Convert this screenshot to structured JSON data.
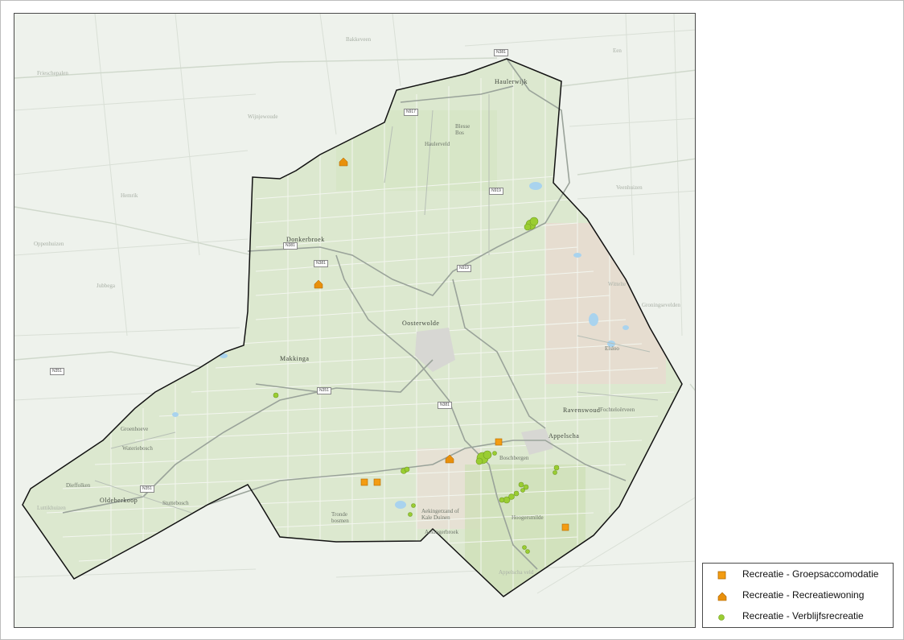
{
  "map": {
    "places": [
      {
        "name": "Haulerwijk",
        "cls": "town"
      },
      {
        "name": "Donkerbroek",
        "cls": "town"
      },
      {
        "name": "Oosterwolde",
        "cls": "town"
      },
      {
        "name": "Makkinga",
        "cls": "town"
      },
      {
        "name": "Appelscha",
        "cls": "town"
      },
      {
        "name": "Ravenswoud",
        "cls": "town"
      },
      {
        "name": "Oldeberkoop",
        "cls": "town"
      },
      {
        "name": "Haulerveld",
        "cls": ""
      },
      {
        "name": "Blesse Bos",
        "cls": ""
      },
      {
        "name": "Boschbergen",
        "cls": ""
      },
      {
        "name": "Hoogersmilde",
        "cls": ""
      },
      {
        "name": "Aekingerzand of Kale Duinen",
        "cls": ""
      },
      {
        "name": "Aekingerbroek",
        "cls": ""
      },
      {
        "name": "Tronde bosmen",
        "cls": ""
      },
      {
        "name": "Groenhoeve",
        "cls": ""
      },
      {
        "name": "Wateriebosch",
        "cls": ""
      },
      {
        "name": "Stuttebosch",
        "cls": ""
      },
      {
        "name": "Dieffolken",
        "cls": ""
      },
      {
        "name": "Fochteloërveen",
        "cls": ""
      },
      {
        "name": "Elsloo",
        "cls": ""
      },
      {
        "name": "Wijnjewoude",
        "cls": "faint"
      },
      {
        "name": "Hemrik",
        "cls": "faint"
      },
      {
        "name": "Jubbega",
        "cls": "faint"
      },
      {
        "name": "Oppenhuizen",
        "cls": "faint"
      },
      {
        "name": "Bakkeveen",
        "cls": "faint"
      },
      {
        "name": "Veenhuizen",
        "cls": "faint"
      },
      {
        "name": "Een",
        "cls": "faint"
      },
      {
        "name": "Wittelte",
        "cls": "faint"
      },
      {
        "name": "Frieschepalen",
        "cls": "faint"
      },
      {
        "name": "Appelscha veld",
        "cls": "faint"
      },
      {
        "name": "Groningsevelden",
        "cls": "faint"
      },
      {
        "name": "Luttikhuizen",
        "cls": "faint"
      }
    ],
    "roads": [
      {
        "label": "N381"
      },
      {
        "label": "N917"
      },
      {
        "label": "N919"
      },
      {
        "label": "N381"
      },
      {
        "label": "N351"
      },
      {
        "label": "N351"
      },
      {
        "label": "N381"
      },
      {
        "label": "N351"
      },
      {
        "label": "N381"
      },
      {
        "label": "N919"
      }
    ],
    "boundary_color": "#111111",
    "land_color": "#dce8cf",
    "outside_color": "#eef2ec"
  },
  "legend": {
    "items": [
      {
        "label": "Recreatie - Groepsaccomodatie",
        "icon": "orange-square-icon",
        "color": "#f39c12"
      },
      {
        "label": "Recreatie - Recreatiewoning",
        "icon": "orange-house-icon",
        "color": "#e8900c"
      },
      {
        "label": "Recreatie - Verblijfsrecreatie",
        "icon": "green-dot-icon",
        "color": "#9acd32"
      }
    ]
  }
}
